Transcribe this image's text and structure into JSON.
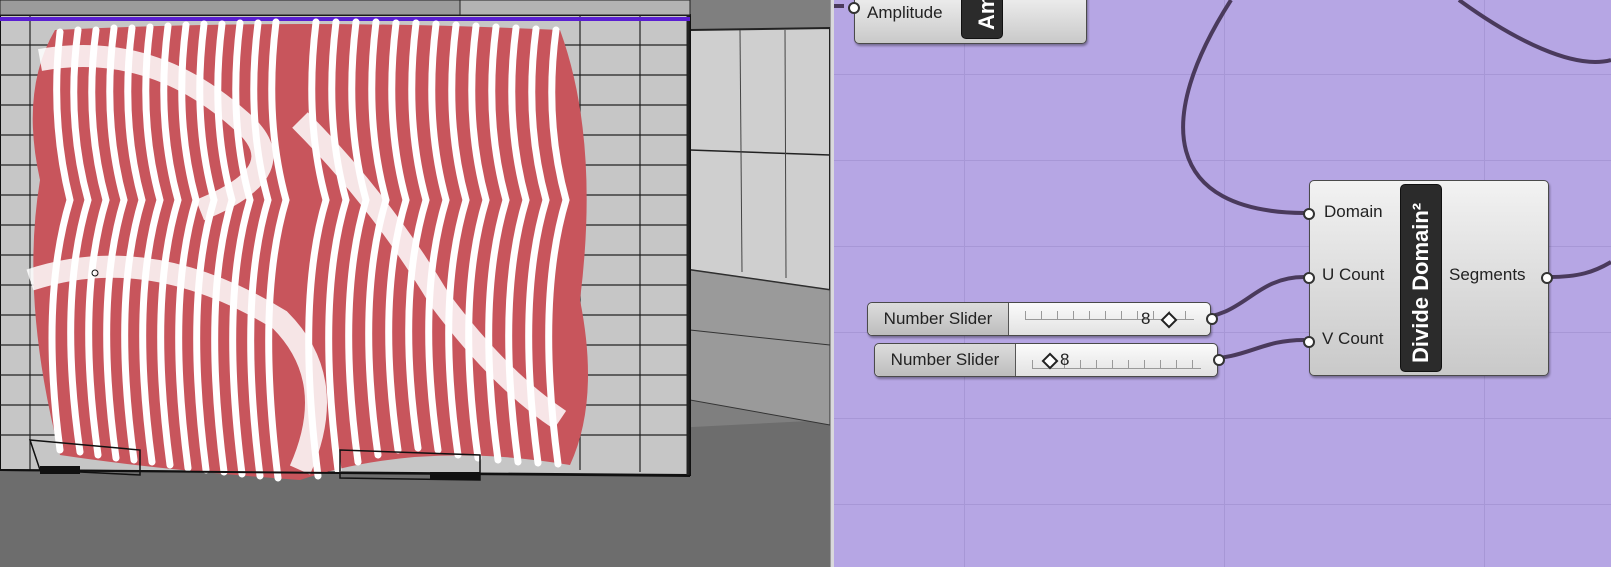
{
  "colors": {
    "canvas_background": "#b6a6e4",
    "viewport_background": "#7a7a7a",
    "wire": "#4a3a5c",
    "component_dark": "#2b2b2b",
    "panel_red": "#c4454d",
    "panel_white": "#ffffff",
    "selection_line": "#5a1fd1"
  },
  "canvas": {
    "amplitude_component": {
      "input_label": "Amplitude",
      "nickname_partial": "Am"
    },
    "divide_domain": {
      "title": "Divide Domain²",
      "inputs": [
        "Domain",
        "U Count",
        "V Count"
      ],
      "output": "Segments"
    },
    "sliders": [
      {
        "name": "Number Slider",
        "value": "8",
        "value_fraction": 0.8
      },
      {
        "name": "Number Slider",
        "value": "8",
        "value_fraction": 0.0
      }
    ]
  }
}
